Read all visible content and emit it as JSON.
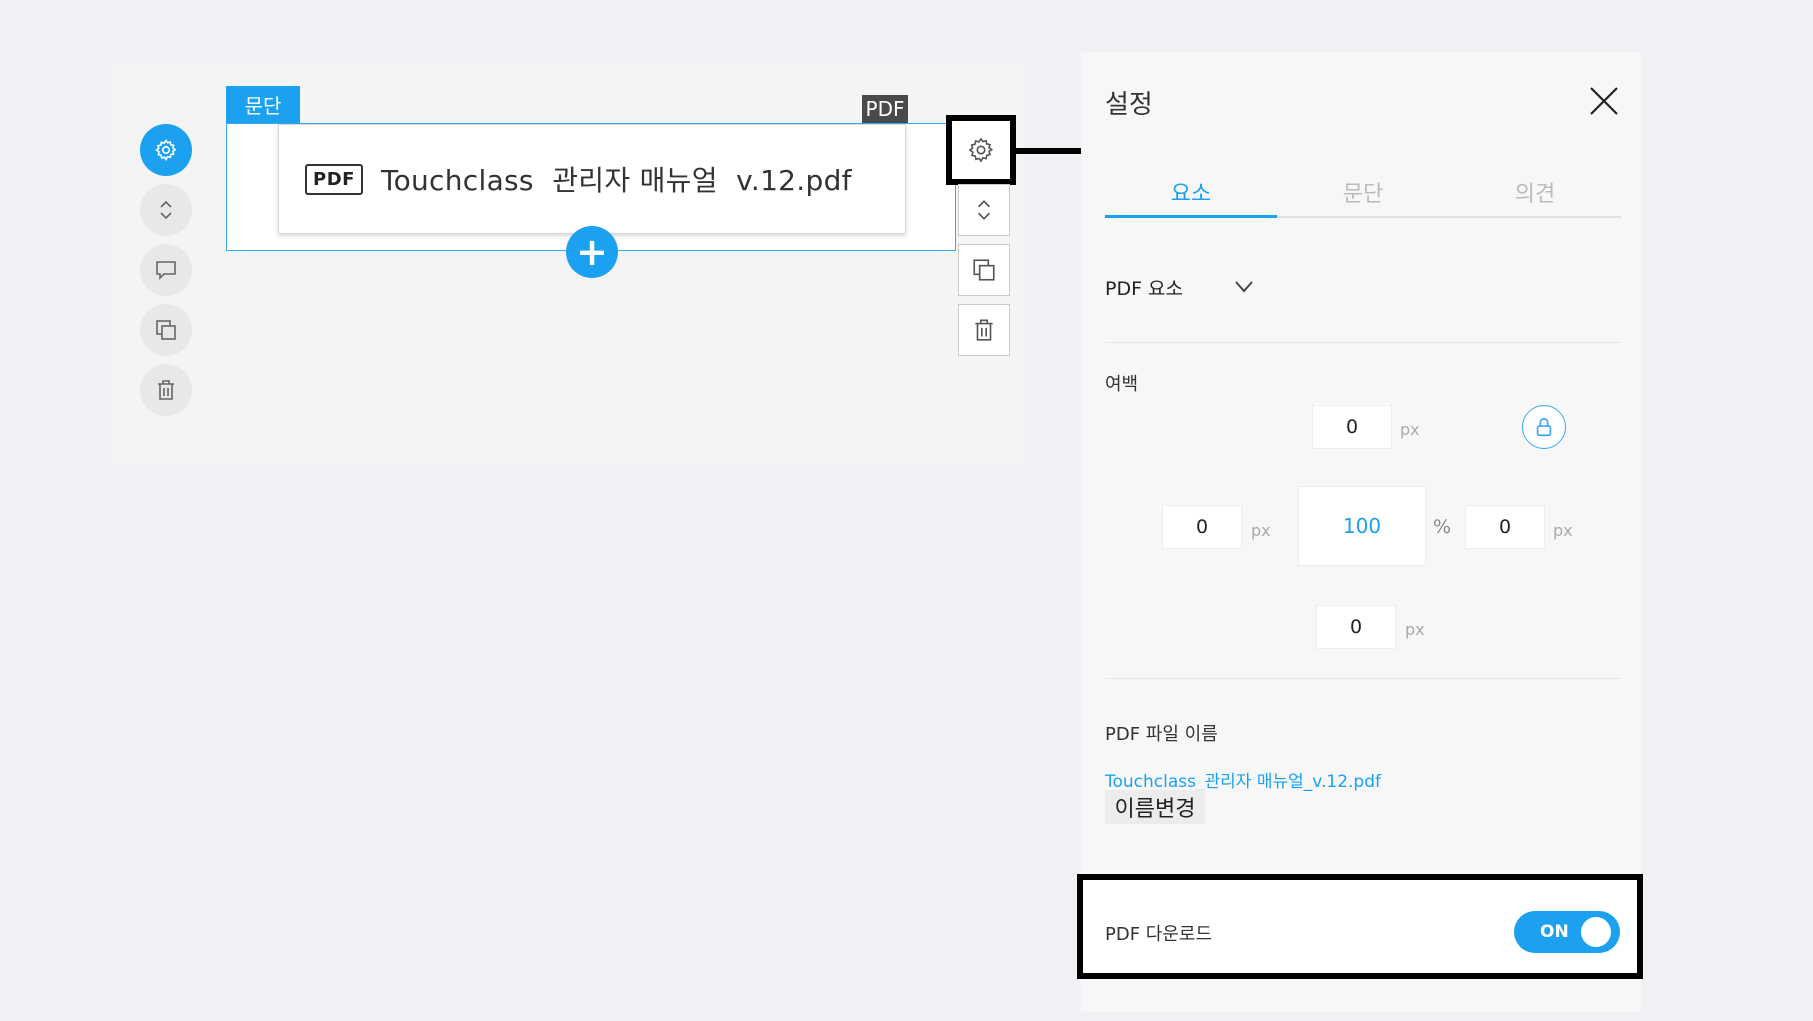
{
  "editor": {
    "paragraph_tag": "문단",
    "pdf_tag": "PDF",
    "pdf_badge": "PDF",
    "pdf_file_name": "Touchclass  관리자 매뉴얼  v.12.pdf",
    "add_label": "+"
  },
  "panel": {
    "title": "설정",
    "tabs": [
      {
        "label": "요소",
        "active": true
      },
      {
        "label": "문단",
        "active": false
      },
      {
        "label": "의견",
        "active": false
      }
    ],
    "element_select": "PDF 요소",
    "margin": {
      "label": "여백",
      "top": "0",
      "top_unit": "px",
      "left": "0",
      "left_unit": "px",
      "width": "100",
      "width_unit": "%",
      "right": "0",
      "right_unit": "px",
      "bottom": "0",
      "bottom_unit": "px"
    },
    "file_section": {
      "label": "PDF 파일 이름",
      "file_name": "Touchclass_관리자 매뉴얼_v.12.pdf",
      "rename_button": "이름변경"
    },
    "download": {
      "label": "PDF 다운로드",
      "toggle_text": "ON",
      "enabled": true
    }
  },
  "colors": {
    "accent": "#1ba1ef",
    "highlight_border": "#000000"
  }
}
